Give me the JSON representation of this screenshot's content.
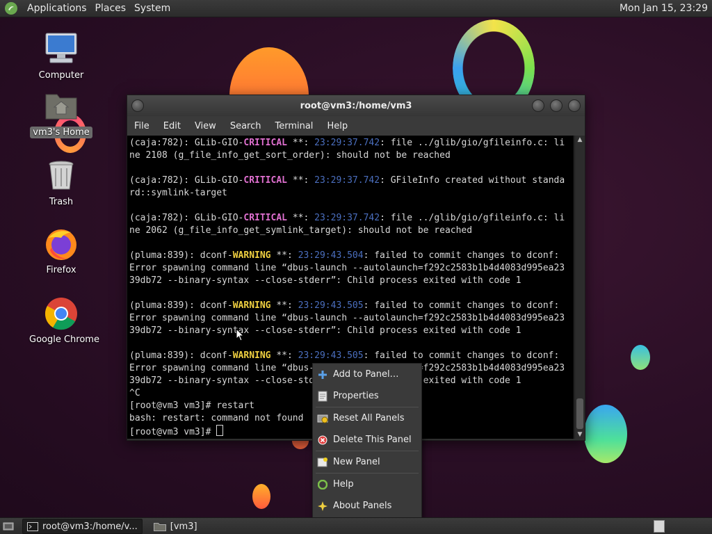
{
  "top_panel": {
    "menus": [
      "Applications",
      "Places",
      "System"
    ],
    "clock": "Mon Jan 15, 23:29"
  },
  "desktop_icons": [
    {
      "label": "Computer",
      "icon": "computer-icon"
    },
    {
      "label": "vm3's Home",
      "icon": "home-folder-icon",
      "selected": true
    },
    {
      "label": "Trash",
      "icon": "trash-icon"
    },
    {
      "label": "Firefox",
      "icon": "firefox-icon"
    },
    {
      "label": "Google Chrome",
      "icon": "chrome-icon"
    }
  ],
  "terminal": {
    "title": "root@vm3:/home/vm3",
    "menus": [
      "File",
      "Edit",
      "View",
      "Search",
      "Terminal",
      "Help"
    ],
    "colors": {
      "critical": "#e070d0",
      "warning": "#f0d040",
      "timestamp": "#4b6fbf"
    },
    "lines": [
      [
        {
          "t": "(caja:782): GLib-GIO-"
        },
        {
          "t": "CRITICAL",
          "c": "crit"
        },
        {
          "t": " **: "
        },
        {
          "t": "23:29:37.742",
          "c": "ts"
        },
        {
          "t": ": file ../glib/gio/gfileinfo.c: li"
        }
      ],
      [
        {
          "t": "ne 2108 (g_file_info_get_sort_order): should not be reached"
        }
      ],
      [],
      [
        {
          "t": "(caja:782): GLib-GIO-"
        },
        {
          "t": "CRITICAL",
          "c": "crit"
        },
        {
          "t": " **: "
        },
        {
          "t": "23:29:37.742",
          "c": "ts"
        },
        {
          "t": ": GFileInfo created without standa"
        }
      ],
      [
        {
          "t": "rd::symlink-target"
        }
      ],
      [],
      [
        {
          "t": "(caja:782): GLib-GIO-"
        },
        {
          "t": "CRITICAL",
          "c": "crit"
        },
        {
          "t": " **: "
        },
        {
          "t": "23:29:37.742",
          "c": "ts"
        },
        {
          "t": ": file ../glib/gio/gfileinfo.c: li"
        }
      ],
      [
        {
          "t": "ne 2062 (g_file_info_get_symlink_target): should not be reached"
        }
      ],
      [],
      [
        {
          "t": "(pluma:839): dconf-"
        },
        {
          "t": "WARNING",
          "c": "warn"
        },
        {
          "t": " **: "
        },
        {
          "t": "23:29:43.504",
          "c": "ts"
        },
        {
          "t": ": failed to commit changes to dconf:"
        }
      ],
      [
        {
          "t": "Error spawning command line “dbus-launch --autolaunch=f292c2583b1b4d4083d995ea23"
        }
      ],
      [
        {
          "t": "39db72 --binary-syntax --close-stderr”: Child process exited with code 1"
        }
      ],
      [],
      [
        {
          "t": "(pluma:839): dconf-"
        },
        {
          "t": "WARNING",
          "c": "warn"
        },
        {
          "t": " **: "
        },
        {
          "t": "23:29:43.505",
          "c": "ts"
        },
        {
          "t": ": failed to commit changes to dconf:"
        }
      ],
      [
        {
          "t": "Error spawning command line “dbus-launch --autolaunch=f292c2583b1b4d4083d995ea23"
        }
      ],
      [
        {
          "t": "39db72 --binary-syntax --close-stderr”: Child process exited with code 1"
        }
      ],
      [],
      [
        {
          "t": "(pluma:839): dconf-"
        },
        {
          "t": "WARNING",
          "c": "warn"
        },
        {
          "t": " **: "
        },
        {
          "t": "23:29:43.505",
          "c": "ts"
        },
        {
          "t": ": failed to commit changes to dconf:"
        }
      ],
      [
        {
          "t": "Error spawning command line “dbus-launch --autolaunch=f292c2583b1b4d4083d995ea23"
        }
      ],
      [
        {
          "t": "39db72 --binary-syntax --close-stderr”: Child process exited with code 1"
        }
      ],
      [
        {
          "t": "^C"
        }
      ],
      [
        {
          "t": "[root@vm3 vm3]# restart"
        }
      ],
      [
        {
          "t": "bash: restart: command not found"
        }
      ],
      [
        {
          "t": "[root@vm3 vm3]# "
        },
        {
          "cursor": true
        }
      ]
    ]
  },
  "context_menu": {
    "items": [
      {
        "label": "Add to Panel…",
        "icon": "add-icon"
      },
      {
        "label": "Properties",
        "icon": "properties-icon"
      },
      {
        "sep": true
      },
      {
        "label": "Reset All Panels",
        "icon": "reset-icon"
      },
      {
        "label": "Delete This Panel",
        "icon": "delete-icon"
      },
      {
        "sep": true
      },
      {
        "label": "New Panel",
        "icon": "new-panel-icon"
      },
      {
        "sep": true
      },
      {
        "label": "Help",
        "icon": "help-icon"
      },
      {
        "label": "About Panels",
        "icon": "about-icon"
      }
    ]
  },
  "bottom_panel": {
    "tasks": [
      {
        "label": "root@vm3:/home/v...",
        "active": true,
        "icon": "terminal-icon"
      },
      {
        "label": "[vm3]",
        "active": false,
        "icon": "folder-icon"
      }
    ]
  }
}
